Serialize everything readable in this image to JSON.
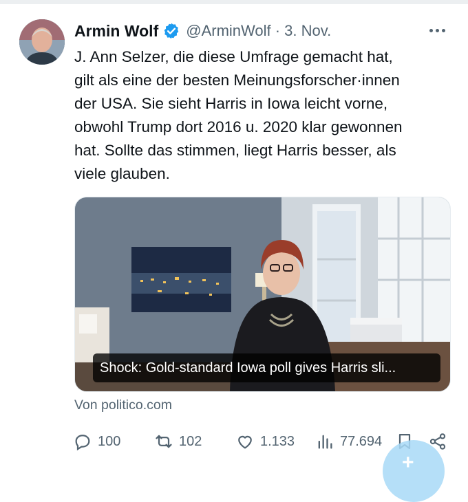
{
  "tweet": {
    "author_name": "Armin Wolf",
    "handle_date": "@ArminWolf · 3. Nov.",
    "text": "J. Ann Selzer, die diese Umfrage gemacht hat,\ngilt als eine der besten Meinungsforscher·innen\nder USA. Sie sieht Harris in Iowa leicht vorne,\nobwohl Trump dort 2016 u. 2020 klar gewonnen\nhat. Sollte das stimmen, liegt Harris besser, als\nviele glauben.",
    "card_caption": "Shock: Gold-standard Iowa poll gives Harris sli...",
    "source": "Von politico.com"
  },
  "actions": {
    "replies": "100",
    "retweets": "102",
    "likes": "1.133",
    "views": "77.694"
  },
  "icons": {
    "verified": "verified-badge-icon",
    "more": "more-dots-icon",
    "reply": "reply-icon",
    "retweet": "retweet-icon",
    "like": "heart-icon",
    "views": "views-bars-icon",
    "bookmark": "bookmark-icon",
    "share": "share-icon",
    "compose": "compose-plus-icon"
  },
  "colors": {
    "verified_blue": "#1d9bf0",
    "muted_text": "#536471",
    "primary_text": "#0f1419"
  }
}
